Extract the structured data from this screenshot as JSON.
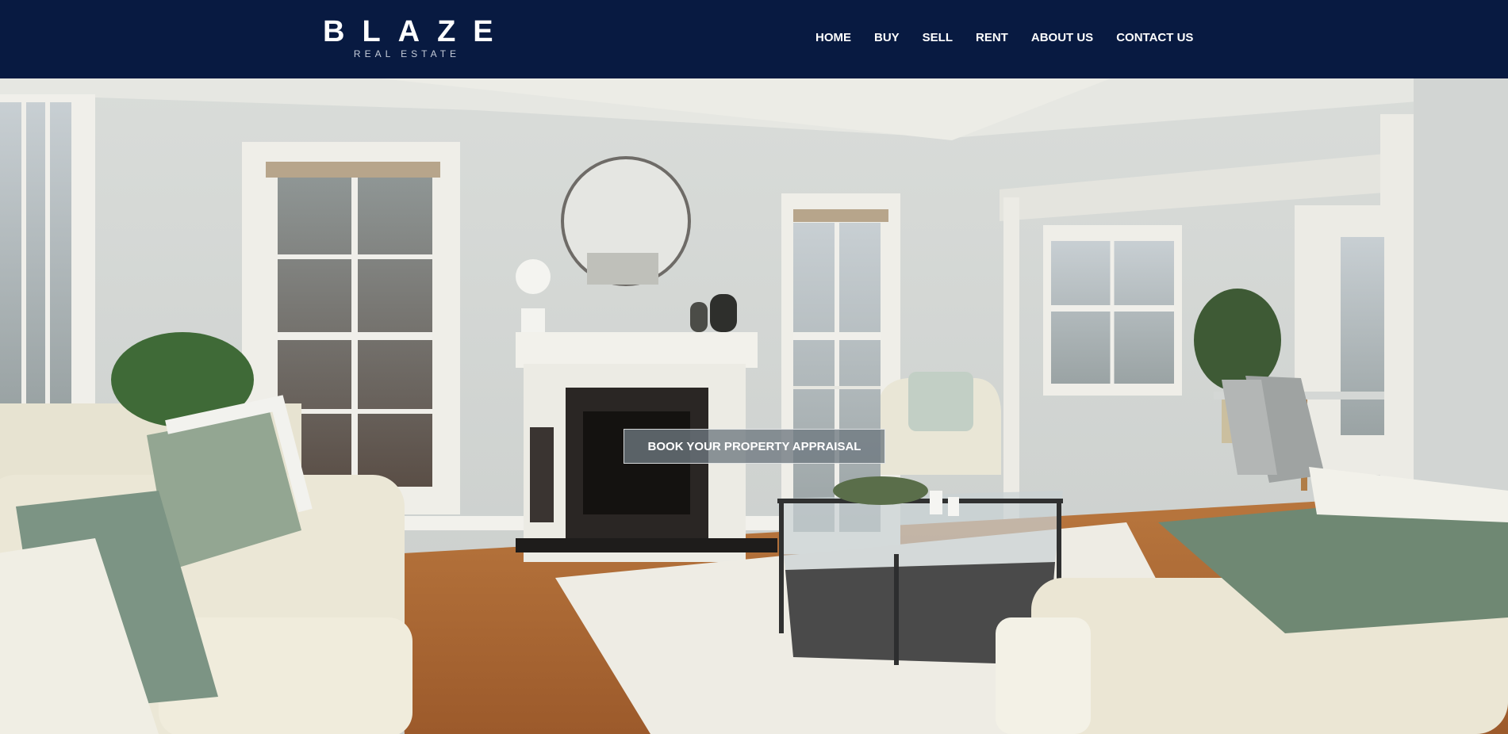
{
  "brand": {
    "name": "BLAZE",
    "tagline": "REAL ESTATE"
  },
  "nav": {
    "items": [
      {
        "label": "HOME"
      },
      {
        "label": "BUY"
      },
      {
        "label": "SELL"
      },
      {
        "label": "RENT"
      },
      {
        "label": "ABOUT US"
      },
      {
        "label": "CONTACT US"
      }
    ]
  },
  "hero": {
    "cta_label": "BOOK YOUR PROPERTY APPRAISAL"
  },
  "colors": {
    "header_bg": "#081a41",
    "nav_text": "#ffffff",
    "cta_bg": "#6e7880"
  }
}
